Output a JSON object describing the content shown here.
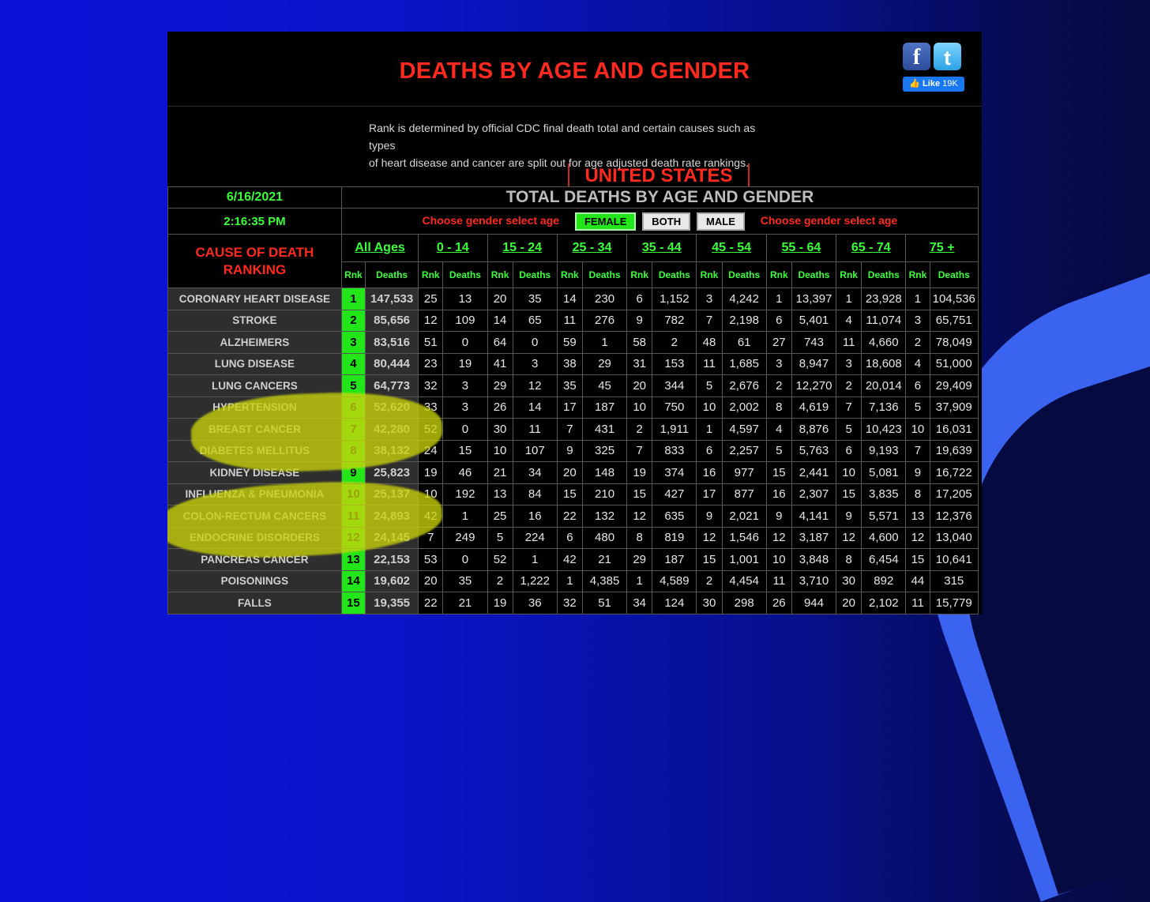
{
  "page": {
    "title": "DEATHS BY AGE AND GENDER",
    "description_line1": "Rank is determined by official CDC final death total and certain causes such as types",
    "description_line2": "of heart disease and cancer are split out for age adjusted death rate rankings.",
    "region": "UNITED STATES",
    "date": "6/16/2021",
    "time": "2:16:35 PM",
    "table_title": "TOTAL DEATHS BY AGE AND GENDER",
    "choose_label": "Choose gender select age",
    "gender_buttons": [
      "FEMALE",
      "BOTH",
      "MALE"
    ],
    "selected_gender": "FEMALE",
    "cause_header_line1": "CAUSE OF DEATH",
    "cause_header_line2": "RANKING",
    "rnk_label": "Rnk",
    "deaths_label": "Deaths"
  },
  "social": {
    "facebook_icon": "facebook-icon",
    "twitter_icon": "twitter-icon",
    "like_label": "Like",
    "like_count": "19K"
  },
  "age_groups": [
    "All Ages",
    "0 - 14",
    "15 - 24",
    "25 - 34",
    "35 - 44",
    "45 - 54",
    "55 - 64",
    "65 - 74",
    "75 +"
  ],
  "rows": [
    {
      "cause": "CORONARY HEART DISEASE",
      "rank": "1",
      "total": "147,533",
      "cells": [
        "25",
        "13",
        "20",
        "35",
        "14",
        "230",
        "6",
        "1,152",
        "3",
        "4,242",
        "1",
        "13,397",
        "1",
        "23,928",
        "1",
        "104,536"
      ]
    },
    {
      "cause": "STROKE",
      "rank": "2",
      "total": "85,656",
      "cells": [
        "12",
        "109",
        "14",
        "65",
        "11",
        "276",
        "9",
        "782",
        "7",
        "2,198",
        "6",
        "5,401",
        "4",
        "11,074",
        "3",
        "65,751"
      ]
    },
    {
      "cause": "ALZHEIMERS",
      "rank": "3",
      "total": "83,516",
      "cells": [
        "51",
        "0",
        "64",
        "0",
        "59",
        "1",
        "58",
        "2",
        "48",
        "61",
        "27",
        "743",
        "11",
        "4,660",
        "2",
        "78,049"
      ]
    },
    {
      "cause": "LUNG DISEASE",
      "rank": "4",
      "total": "80,444",
      "cells": [
        "23",
        "19",
        "41",
        "3",
        "38",
        "29",
        "31",
        "153",
        "11",
        "1,685",
        "3",
        "8,947",
        "3",
        "18,608",
        "4",
        "51,000"
      ]
    },
    {
      "cause": "LUNG CANCERS",
      "rank": "5",
      "total": "64,773",
      "cells": [
        "32",
        "3",
        "29",
        "12",
        "35",
        "45",
        "20",
        "344",
        "5",
        "2,676",
        "2",
        "12,270",
        "2",
        "20,014",
        "6",
        "29,409"
      ]
    },
    {
      "cause": "HYPERTENSION",
      "rank": "6",
      "total": "52,620",
      "cells": [
        "33",
        "3",
        "26",
        "14",
        "17",
        "187",
        "10",
        "750",
        "10",
        "2,002",
        "8",
        "4,619",
        "7",
        "7,136",
        "5",
        "37,909"
      ]
    },
    {
      "cause": "BREAST CANCER",
      "rank": "7",
      "total": "42,280",
      "cells": [
        "52",
        "0",
        "30",
        "11",
        "7",
        "431",
        "2",
        "1,911",
        "1",
        "4,597",
        "4",
        "8,876",
        "5",
        "10,423",
        "10",
        "16,031"
      ]
    },
    {
      "cause": "DIABETES MELLITUS",
      "rank": "8",
      "total": "38,132",
      "cells": [
        "24",
        "15",
        "10",
        "107",
        "9",
        "325",
        "7",
        "833",
        "6",
        "2,257",
        "5",
        "5,763",
        "6",
        "9,193",
        "7",
        "19,639"
      ]
    },
    {
      "cause": "KIDNEY DISEASE",
      "rank": "9",
      "total": "25,823",
      "cells": [
        "19",
        "46",
        "21",
        "34",
        "20",
        "148",
        "19",
        "374",
        "16",
        "977",
        "15",
        "2,441",
        "10",
        "5,081",
        "9",
        "16,722"
      ]
    },
    {
      "cause": "INFLUENZA & PNEUMONIA",
      "rank": "10",
      "total": "25,137",
      "cells": [
        "10",
        "192",
        "13",
        "84",
        "15",
        "210",
        "15",
        "427",
        "17",
        "877",
        "16",
        "2,307",
        "15",
        "3,835",
        "8",
        "17,205"
      ]
    },
    {
      "cause": "COLON-RECTUM CANCERS",
      "rank": "11",
      "total": "24,893",
      "cells": [
        "42",
        "1",
        "25",
        "16",
        "22",
        "132",
        "12",
        "635",
        "9",
        "2,021",
        "9",
        "4,141",
        "9",
        "5,571",
        "13",
        "12,376"
      ]
    },
    {
      "cause": "ENDOCRINE DISORDERS",
      "rank": "12",
      "total": "24,145",
      "cells": [
        "7",
        "249",
        "5",
        "224",
        "6",
        "480",
        "8",
        "819",
        "12",
        "1,546",
        "12",
        "3,187",
        "12",
        "4,600",
        "12",
        "13,040"
      ]
    },
    {
      "cause": "PANCREAS CANCER",
      "rank": "13",
      "total": "22,153",
      "cells": [
        "53",
        "0",
        "52",
        "1",
        "42",
        "21",
        "29",
        "187",
        "15",
        "1,001",
        "10",
        "3,848",
        "8",
        "6,454",
        "15",
        "10,641"
      ]
    },
    {
      "cause": "POISONINGS",
      "rank": "14",
      "total": "19,602",
      "cells": [
        "20",
        "35",
        "2",
        "1,222",
        "1",
        "4,385",
        "1",
        "4,589",
        "2",
        "4,454",
        "11",
        "3,710",
        "30",
        "892",
        "44",
        "315"
      ]
    },
    {
      "cause": "FALLS",
      "rank": "15",
      "total": "19,355",
      "cells": [
        "22",
        "21",
        "19",
        "36",
        "32",
        "51",
        "34",
        "124",
        "30",
        "298",
        "26",
        "944",
        "20",
        "2,102",
        "11",
        "15,779"
      ]
    }
  ],
  "colors": {
    "accent_red": "#ff2a1f",
    "accent_green": "#22e61a",
    "highlighter": "#c8d20a"
  }
}
